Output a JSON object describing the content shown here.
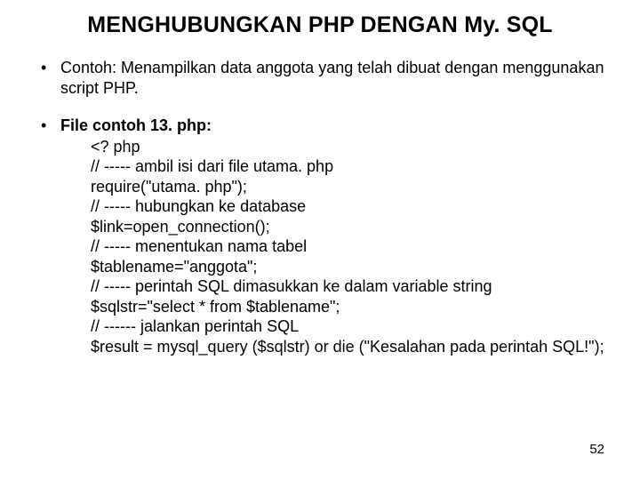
{
  "title": "MENGHUBUNGKAN PHP DENGAN My. SQL",
  "bullet1": "Contoh: Menampilkan data anggota yang telah dibuat dengan menggunakan script PHP.",
  "bullet2_label": "File contoh 13. php:",
  "code": {
    "l1": "<? php",
    "l2": "// ----- ambil isi dari file utama. php",
    "l3": "require(\"utama. php\");",
    "l4": "// ----- hubungkan ke database",
    "l5": "$link=open_connection();",
    "l6": "// ----- menentukan nama tabel",
    "l7": "$tablename=\"anggota\";",
    "l8": "// ----- perintah SQL dimasukkan ke dalam variable string",
    "l9": "$sqlstr=\"select * from $tablename\";",
    "l10": "// ------ jalankan perintah SQL",
    "l11": "$result = mysql_query ($sqlstr) or die (\"Kesalahan pada perintah SQL!\");"
  },
  "page_number": "52"
}
